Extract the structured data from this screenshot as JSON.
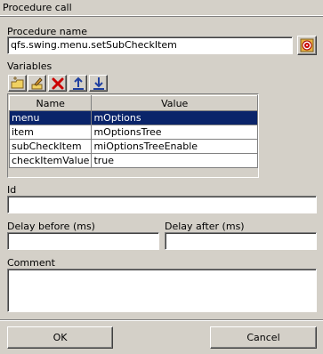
{
  "window": {
    "title": "Procedure call"
  },
  "procedure": {
    "label": "Procedure name",
    "value": "qfs.swing.menu.setSubCheckItem",
    "browse_icon": "target-icon"
  },
  "variables": {
    "label": "Variables",
    "toolbar": [
      {
        "name": "add-icon"
      },
      {
        "name": "edit-icon"
      },
      {
        "name": "delete-icon"
      },
      {
        "name": "move-up-icon"
      },
      {
        "name": "move-down-icon"
      }
    ],
    "columns": [
      "Name",
      "Value"
    ],
    "rows": [
      {
        "name": "menu",
        "value": "mOptions",
        "selected": true
      },
      {
        "name": "item",
        "value": "mOptionsTree",
        "selected": false
      },
      {
        "name": "subCheckItem",
        "value": "miOptionsTreeEnable",
        "selected": false
      },
      {
        "name": "checkItemValue",
        "value": "true",
        "selected": false
      }
    ]
  },
  "id": {
    "label": "Id",
    "value": ""
  },
  "delay_before": {
    "label": "Delay before (ms)",
    "value": ""
  },
  "delay_after": {
    "label": "Delay after (ms)",
    "value": ""
  },
  "comment": {
    "label": "Comment",
    "value": ""
  },
  "buttons": {
    "ok": "OK",
    "cancel": "Cancel"
  },
  "colors": {
    "selection": "#0a246a",
    "background": "#d4d0c8",
    "delete_red": "#cc0000"
  }
}
